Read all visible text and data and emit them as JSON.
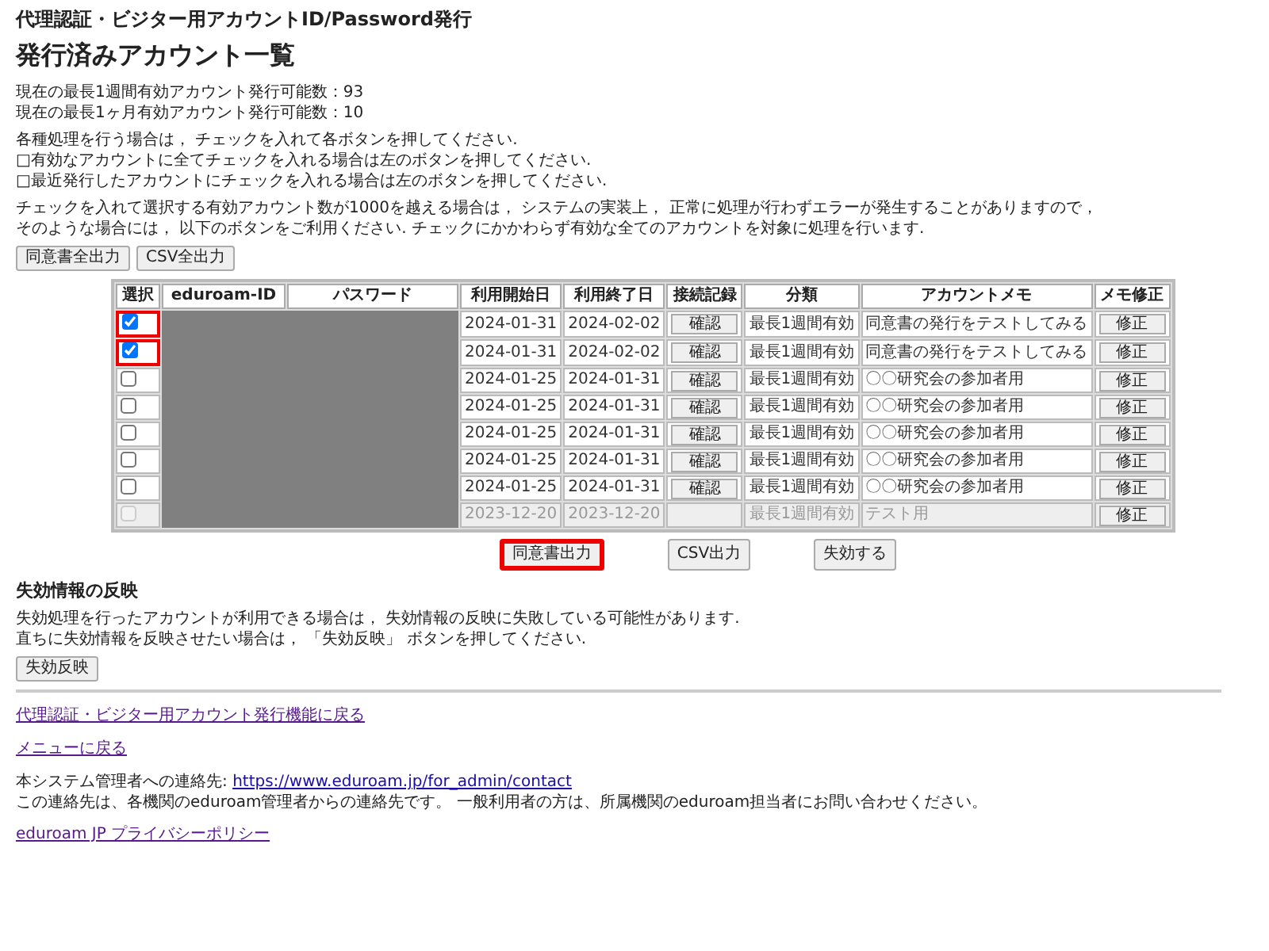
{
  "page_title": "代理認証・ビジター用アカウントID/Password発行",
  "heading": "発行済みアカウント一覧",
  "counts": [
    "現在の最長1週間有効アカウント発行可能数：93",
    "現在の最長1ヶ月有効アカウント発行可能数：10"
  ],
  "instructions": [
    "各種処理を行う場合は， チェックを入れて各ボタンを押してください.",
    "□有効なアカウントに全てチェックを入れる場合は左のボタンを押してください.",
    "□最近発行したアカウントにチェックを入れる場合は左のボタンを押してください."
  ],
  "warning": [
    "チェックを入れて選択する有効アカウント数が1000を越える場合は， システムの実装上， 正常に処理が行わずエラーが発生することがありますので，",
    "そのような場合には， 以下のボタンをご利用ください. チェックにかかわらず有効な全てのアカウントを対象に処理を行います."
  ],
  "bulk_buttons": [
    "同意書全出力",
    "CSV全出力"
  ],
  "table": {
    "columns": [
      "選択",
      "eduroam-ID",
      "パスワード",
      "利用開始日",
      "利用終了日",
      "接続記録",
      "分類",
      "アカウントメモ",
      "メモ修正"
    ],
    "rows": [
      {
        "checked": true,
        "highlighted": true,
        "disabled": false,
        "start": "2024-01-31",
        "end": "2024-02-02",
        "log_button": "確認",
        "category": "最長1週間有効",
        "memo": "同意書の発行をテストしてみる",
        "fix_button": "修正"
      },
      {
        "checked": true,
        "highlighted": true,
        "disabled": false,
        "start": "2024-01-31",
        "end": "2024-02-02",
        "log_button": "確認",
        "category": "最長1週間有効",
        "memo": "同意書の発行をテストしてみる",
        "fix_button": "修正"
      },
      {
        "checked": false,
        "highlighted": false,
        "disabled": false,
        "start": "2024-01-25",
        "end": "2024-01-31",
        "log_button": "確認",
        "category": "最長1週間有効",
        "memo": "〇〇研究会の参加者用",
        "fix_button": "修正"
      },
      {
        "checked": false,
        "highlighted": false,
        "disabled": false,
        "start": "2024-01-25",
        "end": "2024-01-31",
        "log_button": "確認",
        "category": "最長1週間有効",
        "memo": "〇〇研究会の参加者用",
        "fix_button": "修正"
      },
      {
        "checked": false,
        "highlighted": false,
        "disabled": false,
        "start": "2024-01-25",
        "end": "2024-01-31",
        "log_button": "確認",
        "category": "最長1週間有効",
        "memo": "〇〇研究会の参加者用",
        "fix_button": "修正"
      },
      {
        "checked": false,
        "highlighted": false,
        "disabled": false,
        "start": "2024-01-25",
        "end": "2024-01-31",
        "log_button": "確認",
        "category": "最長1週間有効",
        "memo": "〇〇研究会の参加者用",
        "fix_button": "修正"
      },
      {
        "checked": false,
        "highlighted": false,
        "disabled": false,
        "start": "2024-01-25",
        "end": "2024-01-31",
        "log_button": "確認",
        "category": "最長1週間有効",
        "memo": "〇〇研究会の参加者用",
        "fix_button": "修正"
      },
      {
        "checked": false,
        "highlighted": false,
        "disabled": true,
        "start": "2023-12-20",
        "end": "2023-12-20",
        "category": "最長1週間有効",
        "memo": "テスト用",
        "fix_button": "修正"
      }
    ]
  },
  "table_buttons": [
    {
      "label": "同意書出力",
      "highlighted": true
    },
    {
      "label": "CSV出力",
      "highlighted": false
    },
    {
      "label": "失効する",
      "highlighted": false
    }
  ],
  "expiry_section": {
    "title": "失効情報の反映",
    "text": [
      "失効処理を行ったアカウントが利用できる場合は， 失効情報の反映に失敗している可能性があります.",
      "直ちに失効情報を反映させたい場合は， 「失効反映」 ボタンを押してください."
    ],
    "button": "失効反映"
  },
  "links": [
    "代理認証・ビジター用アカウント発行機能に戻る",
    "メニューに戻る"
  ],
  "contact": {
    "label": "本システム管理者への連絡先:",
    "url": "https://www.eduroam.jp/for_admin/contact",
    "note": "この連絡先は、各機関のeduroam管理者からの連絡先です。 一般利用者の方は、所属機関のeduroam担当者にお問い合わせください。"
  },
  "privacy_link": "eduroam JP プライバシーポリシー"
}
